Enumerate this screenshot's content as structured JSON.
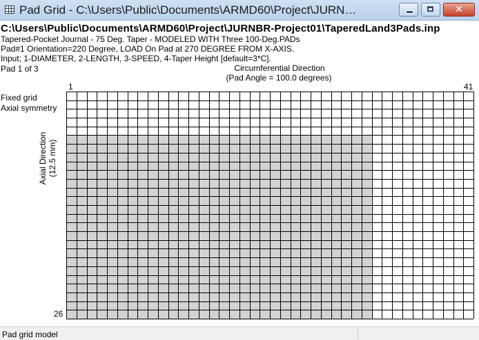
{
  "window": {
    "title": "Pad Grid - C:\\Users\\Public\\Documents\\ARMD60\\Project\\JURNBR...",
    "icon": "grid-icon",
    "controls": {
      "minimize_icon": "minimize-icon",
      "maximize_icon": "maximize-icon",
      "close_glyph": "✕"
    }
  },
  "header": {
    "file_path": "C:\\Users\\Public\\Documents\\ARMD60\\Project\\JURNBR-Project01\\TaperedLand3Pads.inp",
    "line1": "Tapered-Pocket Journal - 75 Deg. Taper - MODELED WITH Three 100-Deg.PADs",
    "line2": "Pad#1 Orientation=220 Degree, LOAD On Pad at 270 DEGREE FROM X-AXIS.",
    "line3": "Input; 1-DIAMETER, 2-LENGTH, 3-SPEED, 4-Taper Height [default=3*C]."
  },
  "grid": {
    "pad_label": "Pad 1 of 3",
    "circumferential_title": "Circumferential Direction",
    "pad_angle_label": "(Pad Angle = 100.0 degrees)",
    "col_first": "1",
    "col_last": "41",
    "row_last": "26",
    "fixed_grid_label": "Fixed grid",
    "axial_symmetry_label": "Axial symmetry",
    "axial_direction_label": "Axial Direction",
    "axial_length_label": "(12.5 mm)",
    "columns": 40,
    "rows": 26,
    "shaded_columns": 30,
    "shaded_start_row": 5,
    "shade_color": "#d3d3d3",
    "line_color": "#000000"
  },
  "statusbar": {
    "text": "Pad grid model"
  }
}
